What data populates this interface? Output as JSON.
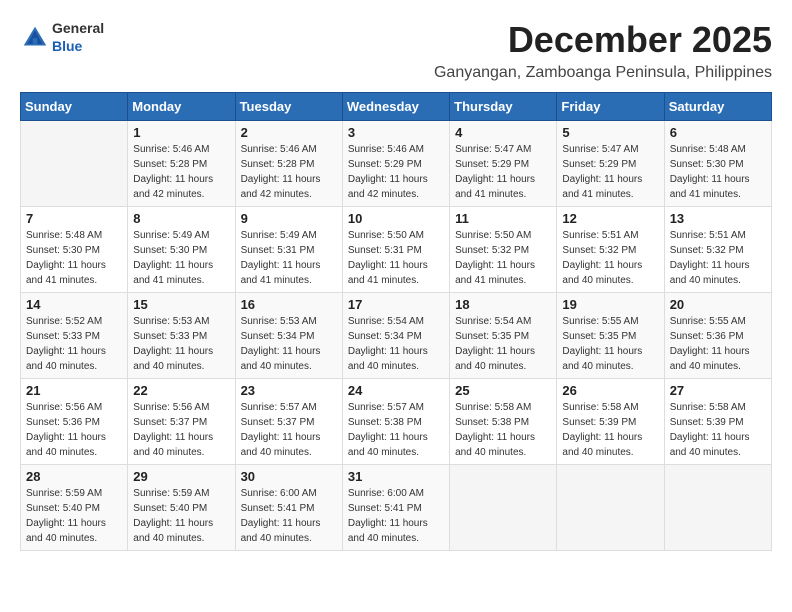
{
  "header": {
    "logo_general": "General",
    "logo_blue": "Blue",
    "title": "December 2025",
    "location": "Ganyangan, Zamboanga Peninsula, Philippines"
  },
  "weekdays": [
    "Sunday",
    "Monday",
    "Tuesday",
    "Wednesday",
    "Thursday",
    "Friday",
    "Saturday"
  ],
  "weeks": [
    [
      {
        "day": "",
        "info": ""
      },
      {
        "day": "1",
        "info": "Sunrise: 5:46 AM\nSunset: 5:28 PM\nDaylight: 11 hours\nand 42 minutes."
      },
      {
        "day": "2",
        "info": "Sunrise: 5:46 AM\nSunset: 5:28 PM\nDaylight: 11 hours\nand 42 minutes."
      },
      {
        "day": "3",
        "info": "Sunrise: 5:46 AM\nSunset: 5:29 PM\nDaylight: 11 hours\nand 42 minutes."
      },
      {
        "day": "4",
        "info": "Sunrise: 5:47 AM\nSunset: 5:29 PM\nDaylight: 11 hours\nand 41 minutes."
      },
      {
        "day": "5",
        "info": "Sunrise: 5:47 AM\nSunset: 5:29 PM\nDaylight: 11 hours\nand 41 minutes."
      },
      {
        "day": "6",
        "info": "Sunrise: 5:48 AM\nSunset: 5:30 PM\nDaylight: 11 hours\nand 41 minutes."
      }
    ],
    [
      {
        "day": "7",
        "info": "Sunrise: 5:48 AM\nSunset: 5:30 PM\nDaylight: 11 hours\nand 41 minutes."
      },
      {
        "day": "8",
        "info": "Sunrise: 5:49 AM\nSunset: 5:30 PM\nDaylight: 11 hours\nand 41 minutes."
      },
      {
        "day": "9",
        "info": "Sunrise: 5:49 AM\nSunset: 5:31 PM\nDaylight: 11 hours\nand 41 minutes."
      },
      {
        "day": "10",
        "info": "Sunrise: 5:50 AM\nSunset: 5:31 PM\nDaylight: 11 hours\nand 41 minutes."
      },
      {
        "day": "11",
        "info": "Sunrise: 5:50 AM\nSunset: 5:32 PM\nDaylight: 11 hours\nand 41 minutes."
      },
      {
        "day": "12",
        "info": "Sunrise: 5:51 AM\nSunset: 5:32 PM\nDaylight: 11 hours\nand 40 minutes."
      },
      {
        "day": "13",
        "info": "Sunrise: 5:51 AM\nSunset: 5:32 PM\nDaylight: 11 hours\nand 40 minutes."
      }
    ],
    [
      {
        "day": "14",
        "info": "Sunrise: 5:52 AM\nSunset: 5:33 PM\nDaylight: 11 hours\nand 40 minutes."
      },
      {
        "day": "15",
        "info": "Sunrise: 5:53 AM\nSunset: 5:33 PM\nDaylight: 11 hours\nand 40 minutes."
      },
      {
        "day": "16",
        "info": "Sunrise: 5:53 AM\nSunset: 5:34 PM\nDaylight: 11 hours\nand 40 minutes."
      },
      {
        "day": "17",
        "info": "Sunrise: 5:54 AM\nSunset: 5:34 PM\nDaylight: 11 hours\nand 40 minutes."
      },
      {
        "day": "18",
        "info": "Sunrise: 5:54 AM\nSunset: 5:35 PM\nDaylight: 11 hours\nand 40 minutes."
      },
      {
        "day": "19",
        "info": "Sunrise: 5:55 AM\nSunset: 5:35 PM\nDaylight: 11 hours\nand 40 minutes."
      },
      {
        "day": "20",
        "info": "Sunrise: 5:55 AM\nSunset: 5:36 PM\nDaylight: 11 hours\nand 40 minutes."
      }
    ],
    [
      {
        "day": "21",
        "info": "Sunrise: 5:56 AM\nSunset: 5:36 PM\nDaylight: 11 hours\nand 40 minutes."
      },
      {
        "day": "22",
        "info": "Sunrise: 5:56 AM\nSunset: 5:37 PM\nDaylight: 11 hours\nand 40 minutes."
      },
      {
        "day": "23",
        "info": "Sunrise: 5:57 AM\nSunset: 5:37 PM\nDaylight: 11 hours\nand 40 minutes."
      },
      {
        "day": "24",
        "info": "Sunrise: 5:57 AM\nSunset: 5:38 PM\nDaylight: 11 hours\nand 40 minutes."
      },
      {
        "day": "25",
        "info": "Sunrise: 5:58 AM\nSunset: 5:38 PM\nDaylight: 11 hours\nand 40 minutes."
      },
      {
        "day": "26",
        "info": "Sunrise: 5:58 AM\nSunset: 5:39 PM\nDaylight: 11 hours\nand 40 minutes."
      },
      {
        "day": "27",
        "info": "Sunrise: 5:58 AM\nSunset: 5:39 PM\nDaylight: 11 hours\nand 40 minutes."
      }
    ],
    [
      {
        "day": "28",
        "info": "Sunrise: 5:59 AM\nSunset: 5:40 PM\nDaylight: 11 hours\nand 40 minutes."
      },
      {
        "day": "29",
        "info": "Sunrise: 5:59 AM\nSunset: 5:40 PM\nDaylight: 11 hours\nand 40 minutes."
      },
      {
        "day": "30",
        "info": "Sunrise: 6:00 AM\nSunset: 5:41 PM\nDaylight: 11 hours\nand 40 minutes."
      },
      {
        "day": "31",
        "info": "Sunrise: 6:00 AM\nSunset: 5:41 PM\nDaylight: 11 hours\nand 40 minutes."
      },
      {
        "day": "",
        "info": ""
      },
      {
        "day": "",
        "info": ""
      },
      {
        "day": "",
        "info": ""
      }
    ]
  ]
}
